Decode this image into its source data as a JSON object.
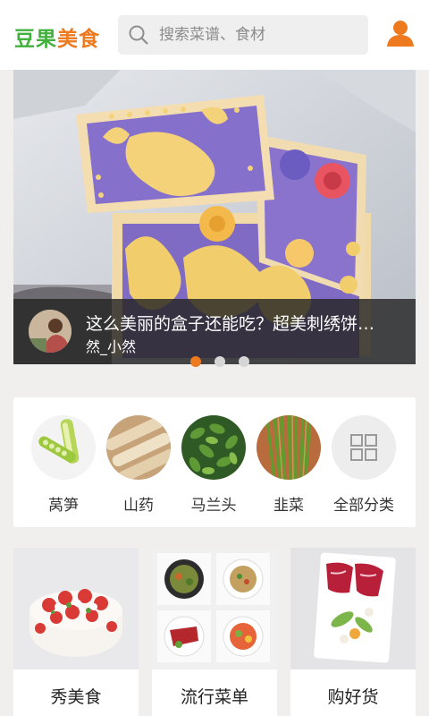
{
  "header": {
    "logo_part1": "豆果",
    "logo_part2": "美食",
    "search_placeholder": "搜索菜谱、食材",
    "icons": {
      "search": "search-icon",
      "user": "user-icon"
    },
    "colors": {
      "logo_green": "#42b03c",
      "accent_orange": "#ee7a20"
    }
  },
  "banner": {
    "title": "这么美丽的盒子还能吃？超美刺绣饼…",
    "author": "然_小然",
    "page_count": 3,
    "active_index": 0,
    "active_dot_color": "#ee7a20"
  },
  "categories": [
    {
      "label": "莴笋"
    },
    {
      "label": "山药"
    },
    {
      "label": "马兰头"
    },
    {
      "label": "韭菜"
    },
    {
      "label": "全部分类",
      "icon": "grid-icon"
    }
  ],
  "cards": [
    {
      "label": "秀美食"
    },
    {
      "label": "流行菜单"
    },
    {
      "label": "购好货"
    }
  ]
}
